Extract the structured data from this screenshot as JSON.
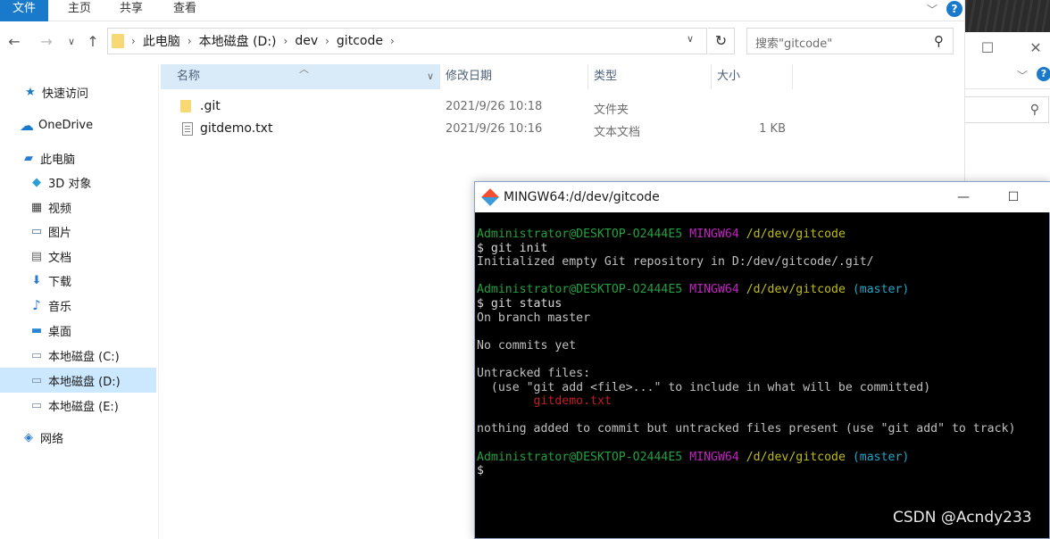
{
  "ribbon": {
    "tabs": [
      "文件",
      "主页",
      "共享",
      "查看"
    ],
    "help": "?"
  },
  "address": {
    "crumbs": [
      "此电脑",
      "本地磁盘 (D:)",
      "dev",
      "gitcode"
    ],
    "search_placeholder": "搜索\"gitcode\""
  },
  "sidebar": {
    "items": [
      {
        "label": "快速访问",
        "icon": "star-icon"
      },
      {
        "label": "OneDrive",
        "icon": "cloud-icon"
      },
      {
        "label": "此电脑",
        "icon": "computer-icon"
      },
      {
        "label": "3D 对象",
        "icon": "cube-icon"
      },
      {
        "label": "视频",
        "icon": "video-icon"
      },
      {
        "label": "图片",
        "icon": "picture-icon"
      },
      {
        "label": "文档",
        "icon": "document-icon"
      },
      {
        "label": "下载",
        "icon": "download-icon"
      },
      {
        "label": "音乐",
        "icon": "music-icon"
      },
      {
        "label": "桌面",
        "icon": "desktop-icon"
      },
      {
        "label": "本地磁盘 (C:)",
        "icon": "drive-icon"
      },
      {
        "label": "本地磁盘 (D:)",
        "icon": "drive-icon",
        "selected": true
      },
      {
        "label": "本地磁盘 (E:)",
        "icon": "drive-icon"
      },
      {
        "label": "网络",
        "icon": "network-icon"
      }
    ]
  },
  "files": {
    "columns": [
      "名称",
      "修改日期",
      "类型",
      "大小"
    ],
    "rows": [
      {
        "name": ".git",
        "date": "2021/9/26 10:18",
        "type": "文件夹",
        "size": "",
        "icon": "folder-icon"
      },
      {
        "name": "gitdemo.txt",
        "date": "2021/9/26 10:16",
        "type": "文本文档",
        "size": "1 KB",
        "icon": "text-file-icon"
      }
    ]
  },
  "terminal": {
    "title": "MINGW64:/d/dev/gitcode",
    "prompt_user": "Administrator@DESKTOP-O2444E5",
    "prompt_sys": "MINGW64",
    "prompt_path": "/d/dev/gitcode",
    "branch": "(master)",
    "cmd1": "$ git init",
    "out1": "Initialized empty Git repository in D:/dev/gitcode/.git/",
    "cmd2": "$ git status",
    "out2a": "On branch master",
    "out2b": "No commits yet",
    "out2c": "Untracked files:",
    "out2d": "  (use \"git add <file>...\" to include in what will be committed)",
    "out2e": "gitdemo.txt",
    "out2f": "nothing added to commit but untracked files present (use \"git add\" to track)",
    "cursor": "$"
  },
  "watermark": "CSDN @Acndy233",
  "colors": {
    "accent": "#1979ca",
    "selected": "#cce8ff",
    "term_green": "#23a03f",
    "term_magenta": "#c61fc5",
    "term_yellow": "#bfbc18",
    "term_cyan": "#1fa5c8",
    "term_red": "#c01d24"
  }
}
